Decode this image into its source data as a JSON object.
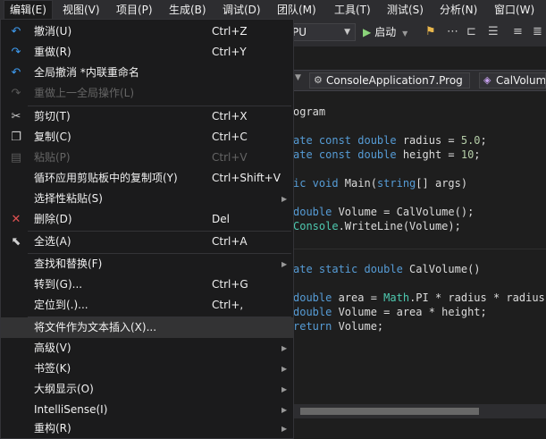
{
  "menubar": {
    "items": [
      "编辑(E)",
      "视图(V)",
      "项目(P)",
      "生成(B)",
      "调试(D)",
      "团队(M)",
      "工具(T)",
      "测试(S)",
      "分析(N)",
      "窗口(W)"
    ]
  },
  "toolbar": {
    "platform": "PU",
    "start": "启动"
  },
  "navbar": {
    "project_combo": "ConsoleApplication7.Prog",
    "member_combo": "CalVolum"
  },
  "code": {
    "lines": [
      "ogram",
      "ate const double radius = 5.0;",
      "ate const double height = 10;",
      "ic void Main(string[] args)",
      "double Volume = CalVolume();",
      "Console.WriteLine(Volume);",
      "ate static double CalVolume()",
      "double area = Math.PI * radius * radius;",
      "double Volume = area * height;",
      "return Volume;"
    ]
  },
  "menu": {
    "undo": "撤消(U)",
    "undo_sc": "Ctrl+Z",
    "redo": "重做(R)",
    "redo_sc": "Ctrl+Y",
    "global_undo": "全局撤消 *内联重命名",
    "global_redo": "重做上一全局操作(L)",
    "cut": "剪切(T)",
    "cut_sc": "Ctrl+X",
    "copy": "复制(C)",
    "copy_sc": "Ctrl+C",
    "paste": "粘贴(P)",
    "paste_sc": "Ctrl+V",
    "cycle_clip": "循环应用剪贴板中的复制项(Y)",
    "cycle_clip_sc": "Ctrl+Shift+V",
    "paste_special": "选择性粘贴(S)",
    "delete": "删除(D)",
    "delete_sc": "Del",
    "select_all": "全选(A)",
    "select_all_sc": "Ctrl+A",
    "find_replace": "查找和替换(F)",
    "goto": "转到(G)...",
    "goto_sc": "Ctrl+G",
    "navigate_to": "定位到(.)...",
    "navigate_to_sc": "Ctrl+,",
    "insert_file": "将文件作为文本插入(X)...",
    "advanced": "高级(V)",
    "bookmarks": "书签(K)",
    "outlining": "大纲显示(O)",
    "intellisense": "IntelliSense(I)",
    "refactor": "重构(R)"
  }
}
